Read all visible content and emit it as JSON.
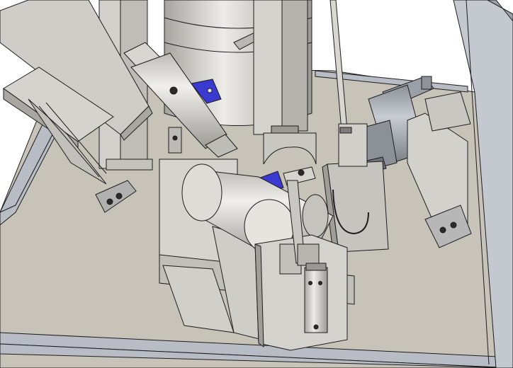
{
  "view": {
    "kind": "3d-cad-assembly-render",
    "background_color": "#ffffff",
    "palette": {
      "steel": "#c9c7c1",
      "steel_light": "#e4e2dd",
      "steel_dark": "#8f8d88",
      "edge": "#1d1d1d",
      "base_plate": "#c7c2b8",
      "frame_rail": "#b9bec6",
      "bracket_blue": "#3a3ad0",
      "cylinder_grey": "#a9adb3"
    }
  }
}
